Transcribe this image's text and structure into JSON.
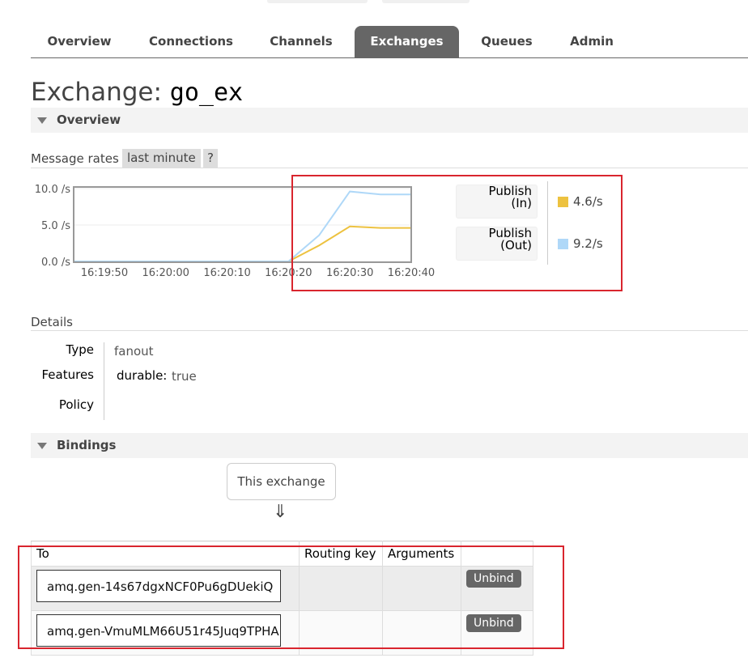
{
  "nav": {
    "tabs": [
      {
        "label": "Overview",
        "active": false
      },
      {
        "label": "Connections",
        "active": false
      },
      {
        "label": "Channels",
        "active": false
      },
      {
        "label": "Exchanges",
        "active": true
      },
      {
        "label": "Queues",
        "active": false
      },
      {
        "label": "Admin",
        "active": false
      }
    ]
  },
  "page": {
    "title_prefix": "Exchange:",
    "exchange_name": "go_ex"
  },
  "overview": {
    "section_label": "Overview",
    "rates_label": "Message rates",
    "range_chip": "last minute",
    "help_chip": "?"
  },
  "chart_data": {
    "type": "line",
    "x": [
      "16:19:45",
      "16:19:50",
      "16:19:55",
      "16:20:00",
      "16:20:05",
      "16:20:10",
      "16:20:15",
      "16:20:20",
      "16:20:25",
      "16:20:30",
      "16:20:35",
      "16:20:40"
    ],
    "x_tick_labels": [
      "16:19:50",
      "16:20:00",
      "16:20:10",
      "16:20:20",
      "16:20:30",
      "16:20:40"
    ],
    "y_tick_labels": [
      "10.0 /s",
      "5.0 /s",
      "0.0 /s"
    ],
    "ylim": [
      0,
      10
    ],
    "grid": true,
    "series": [
      {
        "name": "Publish (In)",
        "color": "#edc240",
        "values": [
          0,
          0,
          0,
          0,
          0,
          0,
          0,
          0,
          2.2,
          4.8,
          4.6,
          4.6
        ]
      },
      {
        "name": "Publish (Out)",
        "color": "#afd8f8",
        "values": [
          0,
          0,
          0,
          0,
          0,
          0,
          0,
          0,
          3.6,
          9.6,
          9.2,
          9.2
        ]
      }
    ]
  },
  "legend": [
    {
      "line1": "Publish",
      "line2": "(In)",
      "value": "4.6/s",
      "color": "#edc240"
    },
    {
      "line1": "Publish",
      "line2": "(Out)",
      "value": "9.2/s",
      "color": "#afd8f8"
    }
  ],
  "details": {
    "label": "Details",
    "type_key": "Type",
    "type_value": "fanout",
    "features_key": "Features",
    "features_durable_key": "durable:",
    "features_durable_value": "true",
    "policy_key": "Policy"
  },
  "bindings": {
    "section_label": "Bindings",
    "this_exchange": "This exchange",
    "arrow": "⇓",
    "headers": [
      "To",
      "Routing key",
      "Arguments",
      ""
    ],
    "rows": [
      {
        "to": "amq.gen-14s67dgxNCF0Pu6gDUekiQ",
        "routing_key": "",
        "arguments": "",
        "action": "Unbind"
      },
      {
        "to": "amq.gen-VmuMLM66U51r45Juq9TPHA",
        "routing_key": "",
        "arguments": "",
        "action": "Unbind"
      }
    ]
  }
}
